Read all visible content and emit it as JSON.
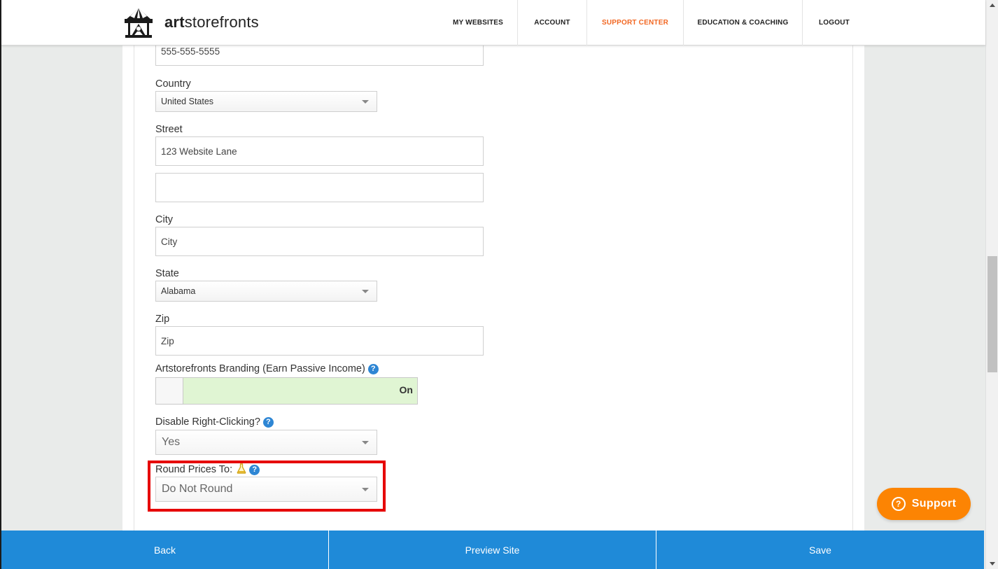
{
  "header": {
    "logo_text_bold": "art",
    "logo_text_rest": "storefronts",
    "nav": [
      {
        "label": "MY WEBSITES",
        "active": false
      },
      {
        "label": "ACCOUNT",
        "active": false
      },
      {
        "label": "SUPPORT CENTER",
        "active": true
      },
      {
        "label": "EDUCATION & COACHING",
        "active": false
      },
      {
        "label": "LOGOUT",
        "active": false
      }
    ]
  },
  "form": {
    "phone": {
      "value": "555-555-5555"
    },
    "country": {
      "label": "Country",
      "value": "United States"
    },
    "street": {
      "label": "Street",
      "value": "123 Website Lane",
      "value2": ""
    },
    "city": {
      "label": "City",
      "placeholder": "City"
    },
    "state": {
      "label": "State",
      "value": "Alabama"
    },
    "zip": {
      "label": "Zip",
      "placeholder": "Zip"
    },
    "branding": {
      "label": "Artstorefronts Branding (Earn Passive Income)",
      "toggle_label": "On",
      "checked": true
    },
    "right_click": {
      "label": "Disable Right-Clicking?",
      "value": "Yes"
    },
    "round_prices": {
      "label": "Round Prices To:",
      "value": "Do Not Round"
    }
  },
  "bottom": {
    "back": "Back",
    "preview": "Preview Site",
    "save": "Save"
  },
  "support": {
    "label": "Support",
    "icon": "?"
  },
  "help_icon": "?",
  "colors": {
    "accent_blue": "#1f8ad8",
    "support_orange": "#fc8403",
    "nav_active": "#f26722",
    "toggle_on_bg": "#e0f5d3",
    "highlight_red": "#e60000"
  }
}
